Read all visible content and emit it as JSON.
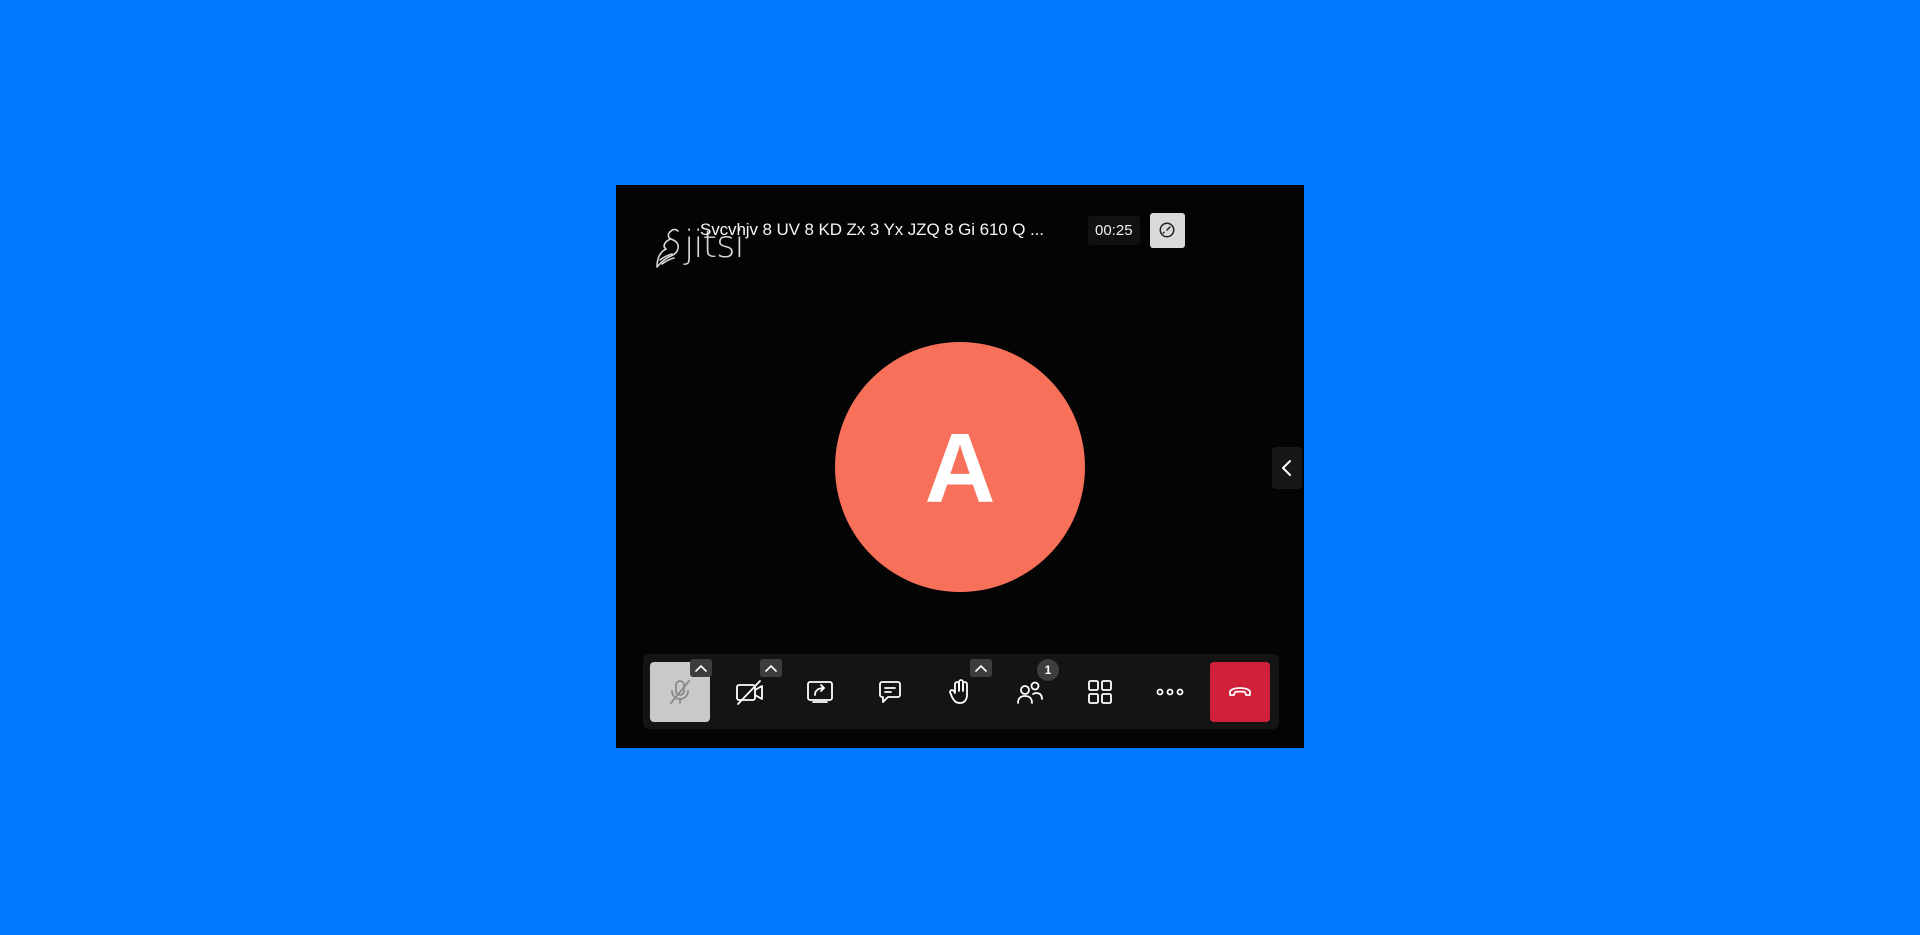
{
  "app": {
    "logo_text": "jitsi",
    "meeting_title": "Svcvhjv 8 UV 8 KD Zx 3 Yx JZQ 8 Gi 610 Q ...",
    "timer": "00:25"
  },
  "participant": {
    "avatar_initial": "A",
    "avatar_color": "#f7705a"
  },
  "toolbar": {
    "participants_count": "1",
    "buttons": [
      {
        "name": "microphone",
        "icon": "mic-off-icon",
        "state": "muted"
      },
      {
        "name": "camera",
        "icon": "camera-off-icon",
        "state": "off"
      },
      {
        "name": "screen-share",
        "icon": "screen-share-icon"
      },
      {
        "name": "chat",
        "icon": "chat-icon"
      },
      {
        "name": "raise-hand",
        "icon": "hand-icon"
      },
      {
        "name": "participants",
        "icon": "participants-icon"
      },
      {
        "name": "tile-view",
        "icon": "grid-icon"
      },
      {
        "name": "more",
        "icon": "more-icon"
      },
      {
        "name": "leave",
        "icon": "hangup-icon"
      }
    ]
  },
  "colors": {
    "background": "#0078ff",
    "hangup": "#d0203a",
    "muted_button": "#c9c9c9"
  }
}
